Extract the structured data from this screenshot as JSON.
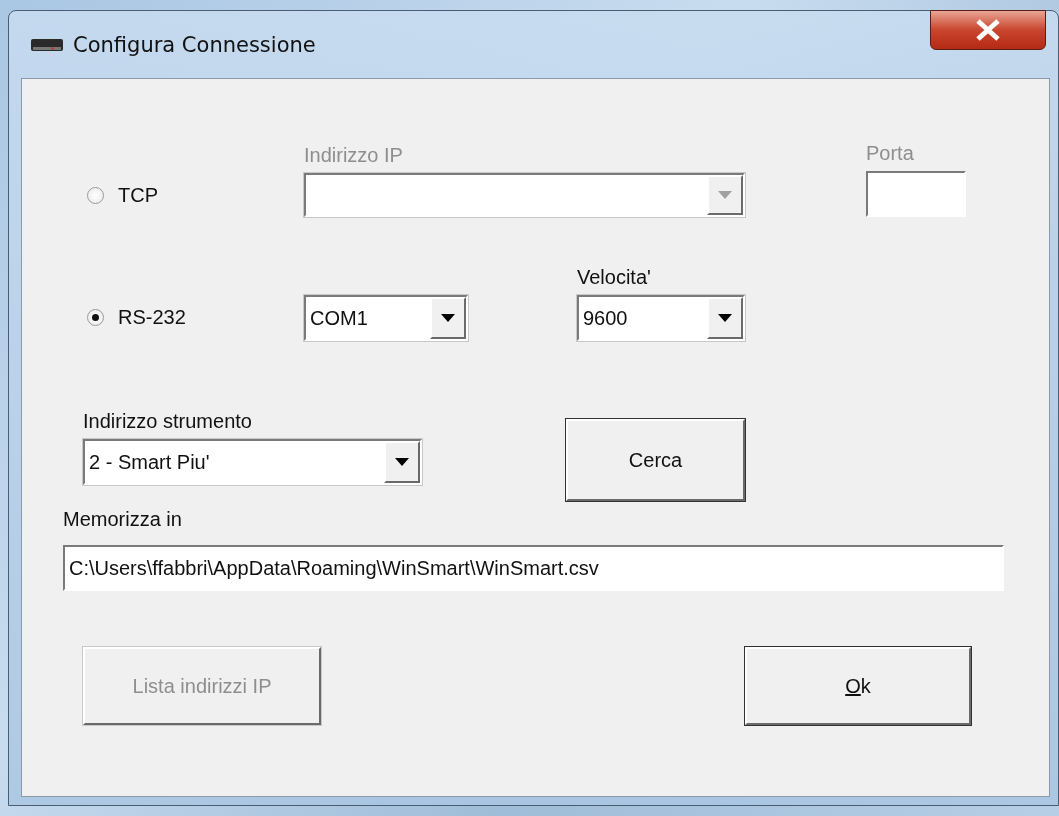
{
  "window": {
    "title": "Configura Connessione"
  },
  "connection": [
    {
      "label": "TCP",
      "selected": false
    },
    {
      "label": "RS-232",
      "selected": true
    }
  ],
  "ip": {
    "label": "Indirizzo IP",
    "disabled": true
  },
  "port": {
    "label": "Porta"
  },
  "com_port": {
    "value": "COM1"
  },
  "speed": {
    "label": "Velocita'",
    "value": "9600"
  },
  "instrument": {
    "label": "Indirizzo strumento",
    "value": "2 - Smart Piu'"
  },
  "search_button": {
    "label": "Cerca"
  },
  "storage": {
    "label": "Memorizza in",
    "value": "C:\\Users\\ffabbri\\AppData\\Roaming\\WinSmart\\WinSmart.csv"
  },
  "buttons": [
    {
      "label": "Lista indirizzi IP",
      "disabled": true,
      "mnemonic_first": false
    },
    {
      "label": "Ok",
      "disabled": false,
      "mnemonic_first": true
    }
  ]
}
